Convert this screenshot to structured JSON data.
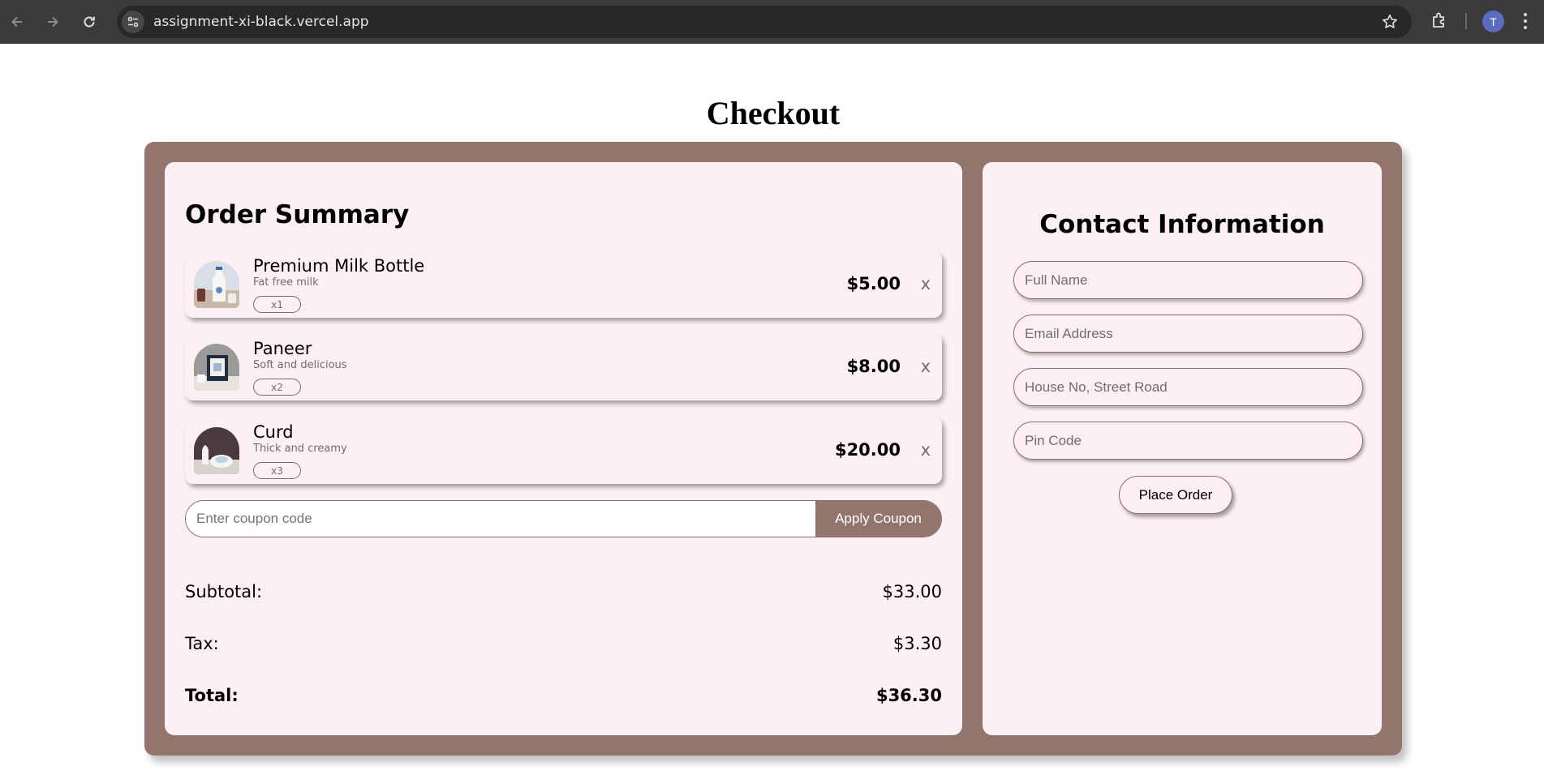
{
  "browser": {
    "url": "assignment-xi-black.vercel.app",
    "profile_initial": "T"
  },
  "page": {
    "title": "Checkout"
  },
  "order_summary": {
    "title": "Order Summary",
    "items": [
      {
        "name": "Premium Milk Bottle",
        "description": "Fat free milk",
        "quantity": "x1",
        "price": "$5.00",
        "remove_label": "x",
        "icon": "milk-bottle-product-image"
      },
      {
        "name": "Paneer",
        "description": "Soft and delicious",
        "quantity": "x2",
        "price": "$8.00",
        "remove_label": "x",
        "icon": "paneer-product-image"
      },
      {
        "name": "Curd",
        "description": "Thick and creamy",
        "quantity": "x3",
        "price": "$20.00",
        "remove_label": "x",
        "icon": "curd-product-image"
      }
    ],
    "coupon": {
      "placeholder": "Enter coupon code",
      "value": "",
      "button_label": "Apply Coupon"
    },
    "subtotal_label": "Subtotal:",
    "subtotal_value": "$33.00",
    "tax_label": "Tax:",
    "tax_value": "$3.30",
    "total_label": "Total:",
    "total_value": "$36.30"
  },
  "contact": {
    "title": "Contact Information",
    "fields": [
      {
        "placeholder": "Full Name",
        "value": ""
      },
      {
        "placeholder": "Email Address",
        "value": ""
      },
      {
        "placeholder": "House No, Street Road",
        "value": ""
      },
      {
        "placeholder": "Pin Code",
        "value": ""
      }
    ],
    "submit_label": "Place Order"
  },
  "colors": {
    "accent": "#94756e",
    "panel_background": "#fdf0f4",
    "chrome_background": "#3b3b3b",
    "omnibox_background": "#282828",
    "avatar": "#5b6bc0"
  }
}
